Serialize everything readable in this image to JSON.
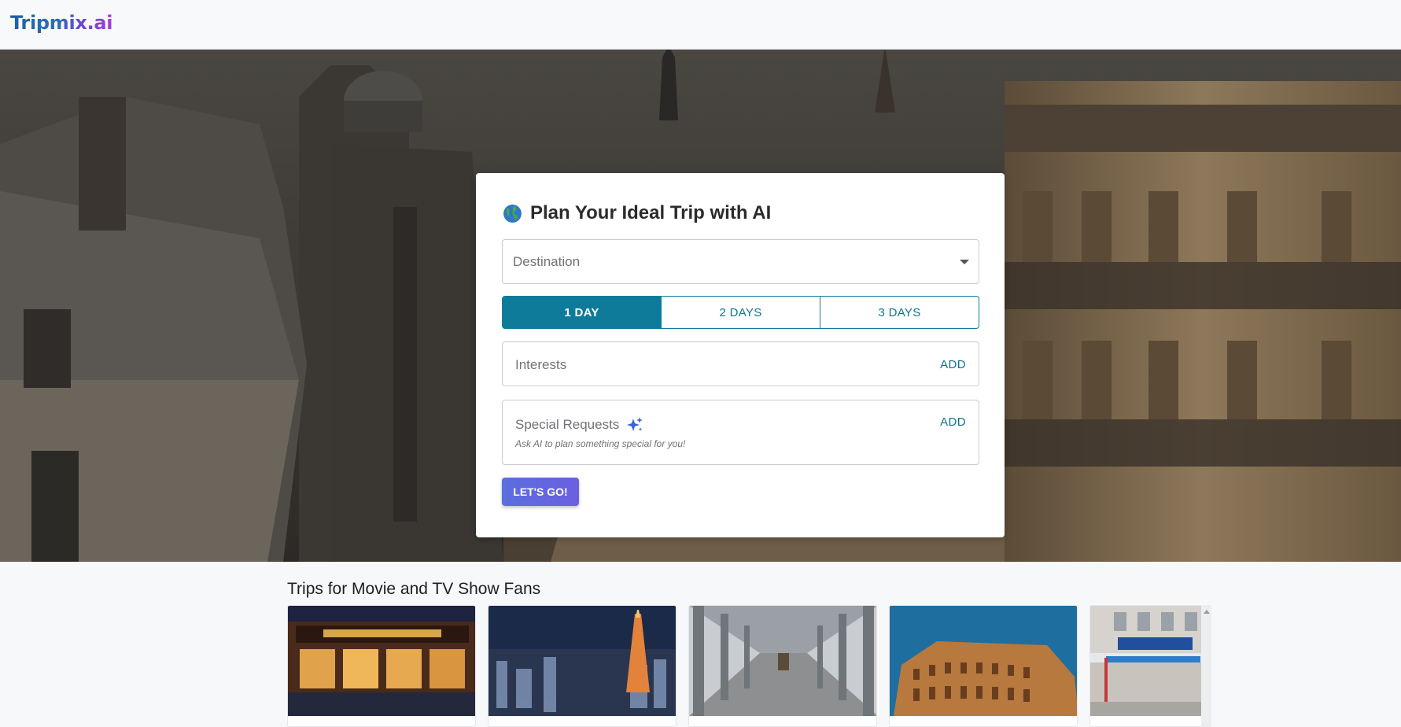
{
  "app": {
    "logo": "Tripmix.ai"
  },
  "planner": {
    "title": "Plan Your Ideal Trip with AI",
    "title_icon": "globe-icon",
    "destination_placeholder": "Destination",
    "durations": [
      {
        "label": "1 DAY",
        "selected": true
      },
      {
        "label": "2 DAYS",
        "selected": false
      },
      {
        "label": "3 DAYS",
        "selected": false
      }
    ],
    "interests_placeholder": "Interests",
    "interests_add": "ADD",
    "special_label": "Special Requests",
    "special_icon": "sparkle-icon",
    "special_hint": "Ask AI to plan something special for you!",
    "special_add": "ADD",
    "submit_label": "LET'S GO!"
  },
  "section": {
    "title": "Trips for Movie and TV Show Fans",
    "cards": [
      {
        "image": "sherlock-holmes-pub-photo"
      },
      {
        "image": "tokyo-tower-night-photo"
      },
      {
        "image": "bir-hakeim-bridge-photo"
      },
      {
        "image": "colosseum-photo"
      },
      {
        "image": "toms-restaurant-photo"
      }
    ]
  },
  "colors": {
    "accent": "#0f7b9b",
    "button_gradient_start": "#5b6ee0",
    "button_gradient_end": "#6b5fe0",
    "logo_gradient_start": "#1f5fa8",
    "logo_gradient_end": "#a43fd0"
  }
}
